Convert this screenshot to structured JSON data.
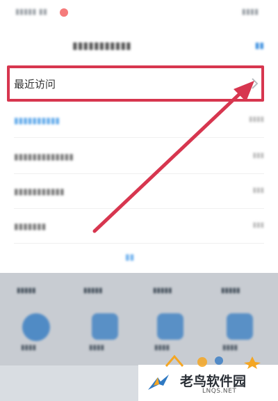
{
  "highlight_row": {
    "label": "最近访问",
    "chevron": "chevron-right-icon"
  },
  "watermark": {
    "brand_cn": "老鸟软件园",
    "brand_en": "LNQS.NET"
  },
  "colors": {
    "highlight_border": "#d7364f",
    "arrow": "#d7364f",
    "accent_blue": "#3b8fdf",
    "overlay": "#c8ccd2"
  }
}
